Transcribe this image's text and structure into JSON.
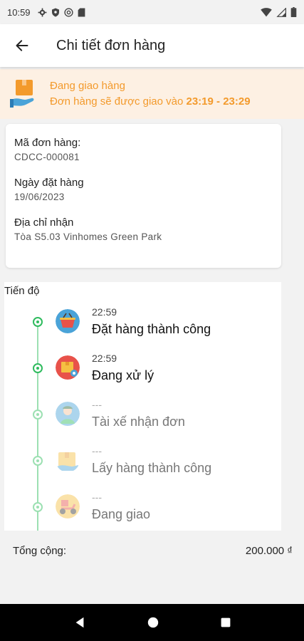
{
  "status_bar": {
    "time": "10:59",
    "left_icons": [
      "gear-icon",
      "shield-icon",
      "at-sign-icon",
      "sd-card-icon"
    ],
    "right_icons": [
      "wifi-icon",
      "signal-icon",
      "battery-icon"
    ]
  },
  "app_bar": {
    "title": "Chi tiết đơn hàng",
    "back_icon": "arrow-left-icon"
  },
  "delivery_banner": {
    "status": "Đang giao hàng",
    "eta_prefix": "Đơn hàng sẽ được giao vào",
    "eta_time": "23:19 - 23:29",
    "accent_color": "#f39a2c",
    "background_color": "#fdf0e3"
  },
  "order_info": {
    "order_id_label": "Mã đơn hàng:",
    "order_id": "CDCC-000081",
    "order_date_label": "Ngày đặt hàng",
    "order_date": "19/06/2023",
    "address_label": "Địa chỉ nhận",
    "address": "Tòa S5.03 Vinhomes Green Park"
  },
  "progress": {
    "title": "Tiến độ",
    "steps": [
      {
        "time": "22:59",
        "label": "Đặt hàng thành công",
        "icon": "basket-icon",
        "done": true
      },
      {
        "time": "22:59",
        "label": "Đang xử lý",
        "icon": "processing-box-icon",
        "done": true
      },
      {
        "time": "---",
        "label": "Tài xế nhận đơn",
        "icon": "driver-icon",
        "done": false
      },
      {
        "time": "---",
        "label": "Lấy hàng thành công",
        "icon": "package-pickup-icon",
        "done": false
      },
      {
        "time": "---",
        "label": "Đang giao",
        "icon": "delivery-scooter-icon",
        "done": false
      }
    ],
    "done_color": "#2fbb5e",
    "pending_color": "#9ce0b2"
  },
  "total": {
    "label": "Tổng cộng:",
    "amount": "200.000 ₫"
  },
  "nav_bar": {
    "icons": [
      "back-triangle-icon",
      "home-circle-icon",
      "recents-square-icon"
    ]
  }
}
